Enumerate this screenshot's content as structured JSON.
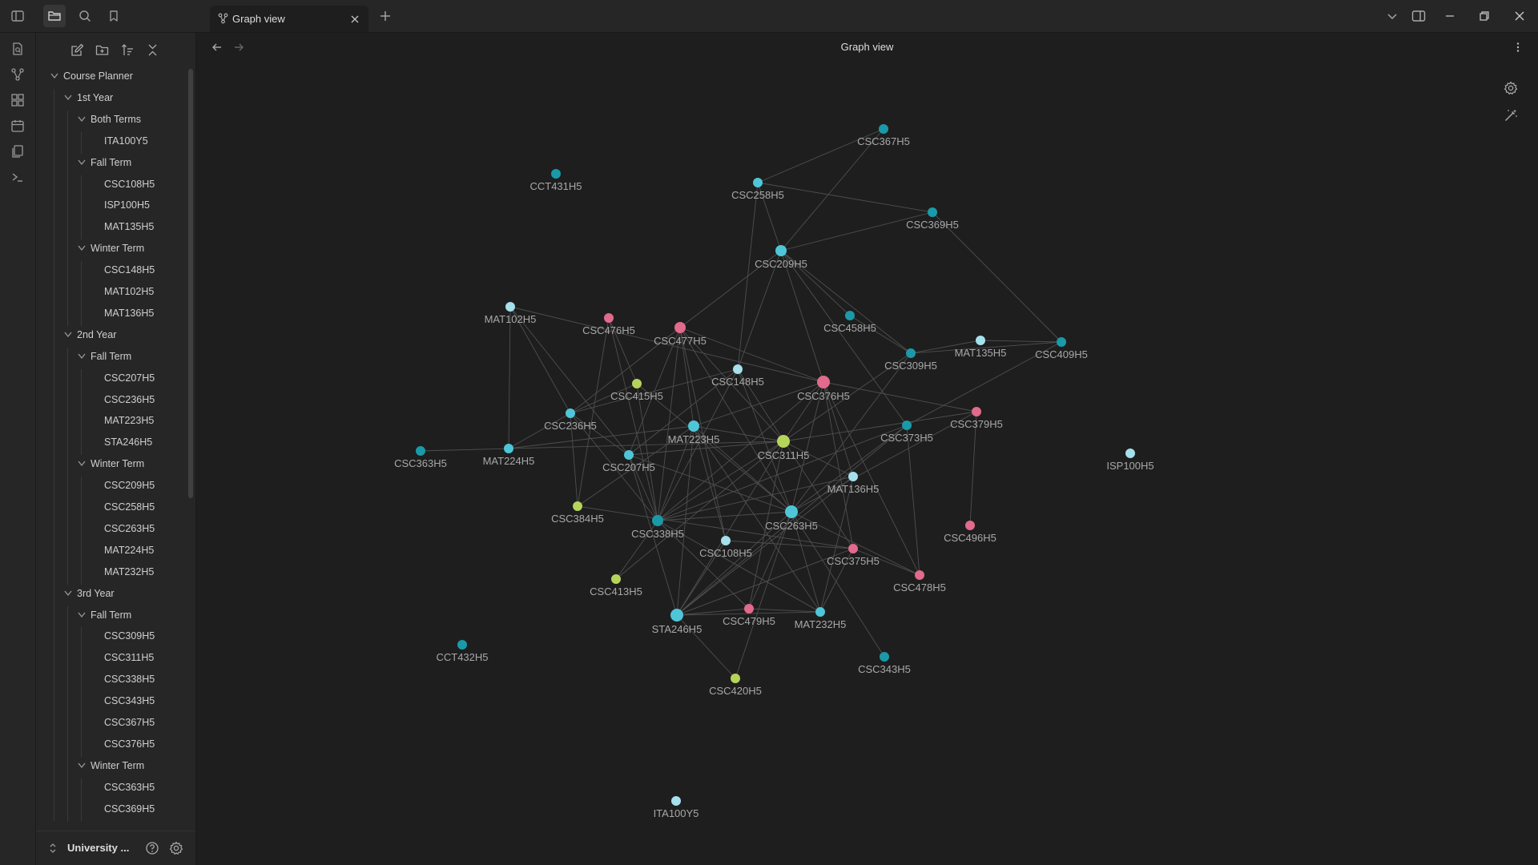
{
  "tab": {
    "title": "Graph view"
  },
  "view": {
    "title": "Graph view"
  },
  "sidebar": {
    "vault_name": "University ...",
    "tree": [
      {
        "label": "Course Planner",
        "depth": 0,
        "folder": true
      },
      {
        "label": "1st Year",
        "depth": 1,
        "folder": true
      },
      {
        "label": "Both Terms",
        "depth": 2,
        "folder": true
      },
      {
        "label": "ITA100Y5",
        "depth": 3,
        "folder": false
      },
      {
        "label": "Fall Term",
        "depth": 2,
        "folder": true
      },
      {
        "label": "CSC108H5",
        "depth": 3,
        "folder": false
      },
      {
        "label": "ISP100H5",
        "depth": 3,
        "folder": false
      },
      {
        "label": "MAT135H5",
        "depth": 3,
        "folder": false
      },
      {
        "label": "Winter Term",
        "depth": 2,
        "folder": true
      },
      {
        "label": "CSC148H5",
        "depth": 3,
        "folder": false
      },
      {
        "label": "MAT102H5",
        "depth": 3,
        "folder": false
      },
      {
        "label": "MAT136H5",
        "depth": 3,
        "folder": false
      },
      {
        "label": "2nd Year",
        "depth": 1,
        "folder": true
      },
      {
        "label": "Fall Term",
        "depth": 2,
        "folder": true
      },
      {
        "label": "CSC207H5",
        "depth": 3,
        "folder": false
      },
      {
        "label": "CSC236H5",
        "depth": 3,
        "folder": false
      },
      {
        "label": "MAT223H5",
        "depth": 3,
        "folder": false
      },
      {
        "label": "STA246H5",
        "depth": 3,
        "folder": false
      },
      {
        "label": "Winter Term",
        "depth": 2,
        "folder": true
      },
      {
        "label": "CSC209H5",
        "depth": 3,
        "folder": false
      },
      {
        "label": "CSC258H5",
        "depth": 3,
        "folder": false
      },
      {
        "label": "CSC263H5",
        "depth": 3,
        "folder": false
      },
      {
        "label": "MAT224H5",
        "depth": 3,
        "folder": false
      },
      {
        "label": "MAT232H5",
        "depth": 3,
        "folder": false
      },
      {
        "label": "3rd Year",
        "depth": 1,
        "folder": true
      },
      {
        "label": "Fall Term",
        "depth": 2,
        "folder": true
      },
      {
        "label": "CSC309H5",
        "depth": 3,
        "folder": false
      },
      {
        "label": "CSC311H5",
        "depth": 3,
        "folder": false
      },
      {
        "label": "CSC338H5",
        "depth": 3,
        "folder": false
      },
      {
        "label": "CSC343H5",
        "depth": 3,
        "folder": false
      },
      {
        "label": "CSC367H5",
        "depth": 3,
        "folder": false
      },
      {
        "label": "CSC376H5",
        "depth": 3,
        "folder": false
      },
      {
        "label": "Winter Term",
        "depth": 2,
        "folder": true
      },
      {
        "label": "CSC363H5",
        "depth": 3,
        "folder": false
      },
      {
        "label": "CSC369H5",
        "depth": 3,
        "folder": false
      }
    ]
  },
  "colors": {
    "light": "#a5e0ec",
    "cyan": "#4fc6d8",
    "teal": "#1a9aa8",
    "pink": "#e26a8c",
    "lime": "#b6d45c",
    "edge": "#4f4f4f",
    "label": "#a8a8a8"
  },
  "graph": {
    "nodes": [
      {
        "id": "CSC367H5",
        "color": "teal"
      },
      {
        "id": "CCT431H5",
        "color": "teal"
      },
      {
        "id": "CSC258H5",
        "color": "cyan"
      },
      {
        "id": "CSC369H5",
        "color": "teal"
      },
      {
        "id": "CSC209H5",
        "color": "cyan"
      },
      {
        "id": "MAT102H5",
        "color": "light"
      },
      {
        "id": "CSC476H5",
        "color": "pink"
      },
      {
        "id": "CSC477H5",
        "color": "pink"
      },
      {
        "id": "CSC458H5",
        "color": "teal"
      },
      {
        "id": "MAT135H5",
        "color": "light"
      },
      {
        "id": "CSC409H5",
        "color": "teal"
      },
      {
        "id": "CSC309H5",
        "color": "teal"
      },
      {
        "id": "CSC148H5",
        "color": "light"
      },
      {
        "id": "CSC415H5",
        "color": "lime"
      },
      {
        "id": "CSC376H5",
        "color": "pink"
      },
      {
        "id": "CSC379H5",
        "color": "pink"
      },
      {
        "id": "CSC236H5",
        "color": "cyan"
      },
      {
        "id": "MAT223H5",
        "color": "cyan"
      },
      {
        "id": "CSC373H5",
        "color": "teal"
      },
      {
        "id": "CSC363H5",
        "color": "teal"
      },
      {
        "id": "MAT224H5",
        "color": "cyan"
      },
      {
        "id": "CSC207H5",
        "color": "cyan"
      },
      {
        "id": "CSC311H5",
        "color": "lime"
      },
      {
        "id": "ISP100H5",
        "color": "light"
      },
      {
        "id": "MAT136H5",
        "color": "light"
      },
      {
        "id": "CSC384H5",
        "color": "lime"
      },
      {
        "id": "CSC338H5",
        "color": "teal"
      },
      {
        "id": "CSC263H5",
        "color": "cyan"
      },
      {
        "id": "CSC496H5",
        "color": "pink"
      },
      {
        "id": "CSC108H5",
        "color": "light"
      },
      {
        "id": "CSC375H5",
        "color": "pink"
      },
      {
        "id": "CSC478H5",
        "color": "pink"
      },
      {
        "id": "CSC413H5",
        "color": "lime"
      },
      {
        "id": "STA246H5",
        "color": "cyan"
      },
      {
        "id": "CSC479H5",
        "color": "pink"
      },
      {
        "id": "MAT232H5",
        "color": "cyan"
      },
      {
        "id": "CCT432H5",
        "color": "teal"
      },
      {
        "id": "CSC343H5",
        "color": "teal"
      },
      {
        "id": "CSC420H5",
        "color": "lime"
      },
      {
        "id": "ITA100Y5",
        "color": "light"
      }
    ],
    "edges": [
      [
        "CSC367H5",
        "CSC258H5"
      ],
      [
        "CSC367H5",
        "CSC209H5"
      ],
      [
        "CSC258H5",
        "CSC369H5"
      ],
      [
        "CSC209H5",
        "CSC369H5"
      ],
      [
        "CSC258H5",
        "CSC209H5"
      ],
      [
        "CSC258H5",
        "CSC148H5"
      ],
      [
        "CSC369H5",
        "CSC409H5"
      ],
      [
        "CSC209H5",
        "CSC148H5"
      ],
      [
        "CSC209H5",
        "CSC309H5"
      ],
      [
        "CSC209H5",
        "CSC458H5"
      ],
      [
        "CSC209H5",
        "CSC376H5"
      ],
      [
        "CSC209H5",
        "CSC477H5"
      ],
      [
        "CSC209H5",
        "CSC373H5"
      ],
      [
        "MAT135H5",
        "CSC409H5"
      ],
      [
        "MAT135H5",
        "CSC309H5"
      ],
      [
        "CSC309H5",
        "CSC409H5"
      ],
      [
        "CSC458H5",
        "CSC309H5"
      ],
      [
        "CSC409H5",
        "CSC373H5"
      ],
      [
        "MAT102H5",
        "CSC236H5"
      ],
      [
        "MAT102H5",
        "MAT224H5"
      ],
      [
        "MAT102H5",
        "CSC376H5"
      ],
      [
        "MAT102H5",
        "CSC207H5"
      ],
      [
        "CSC476H5",
        "CSC415H5"
      ],
      [
        "CSC476H5",
        "CSC384H5"
      ],
      [
        "CSC476H5",
        "CSC338H5"
      ],
      [
        "CSC477H5",
        "CSC236H5"
      ],
      [
        "CSC477H5",
        "CSC311H5"
      ],
      [
        "CSC477H5",
        "MAT223H5"
      ],
      [
        "CSC477H5",
        "CSC338H5"
      ],
      [
        "CSC477H5",
        "CSC207H5"
      ],
      [
        "CSC477H5",
        "CSC108H5"
      ],
      [
        "CSC477H5",
        "CSC263H5"
      ],
      [
        "CSC477H5",
        "CSC376H5"
      ],
      [
        "CSC148H5",
        "CSC207H5"
      ],
      [
        "CSC148H5",
        "CSC236H5"
      ],
      [
        "CSC148H5",
        "CSC263H5"
      ],
      [
        "CSC148H5",
        "CSC338H5"
      ],
      [
        "CSC148H5",
        "CSC375H5"
      ],
      [
        "CSC415H5",
        "CSC338H5"
      ],
      [
        "CSC415H5",
        "CSC236H5"
      ],
      [
        "CSC415H5",
        "CSC263H5"
      ],
      [
        "CSC376H5",
        "MAT223H5"
      ],
      [
        "CSC376H5",
        "CSC311H5"
      ],
      [
        "CSC376H5",
        "CSC263H5"
      ],
      [
        "CSC376H5",
        "CSC478H5"
      ],
      [
        "CSC376H5",
        "CSC379H5"
      ],
      [
        "CSC376H5",
        "MAT136H5"
      ],
      [
        "CSC376H5",
        "CSC338H5"
      ],
      [
        "CSC376H5",
        "CSC375H5"
      ],
      [
        "CSC309H5",
        "CSC311H5"
      ],
      [
        "CSC309H5",
        "CSC263H5"
      ],
      [
        "CSC379H5",
        "CSC496H5"
      ],
      [
        "CSC379H5",
        "CSC263H5"
      ],
      [
        "CSC379H5",
        "CSC311H5"
      ],
      [
        "CSC373H5",
        "CSC263H5"
      ],
      [
        "CSC373H5",
        "CSC478H5"
      ],
      [
        "CSC373H5",
        "CSC338H5"
      ],
      [
        "CSC373H5",
        "STA246H5"
      ],
      [
        "CSC236H5",
        "MAT224H5"
      ],
      [
        "CSC236H5",
        "CSC207H5"
      ],
      [
        "CSC236H5",
        "CSC384H5"
      ],
      [
        "CSC236H5",
        "CSC338H5"
      ],
      [
        "MAT223H5",
        "MAT224H5"
      ],
      [
        "MAT223H5",
        "CSC311H5"
      ],
      [
        "MAT223H5",
        "CSC338H5"
      ],
      [
        "MAT223H5",
        "CSC263H5"
      ],
      [
        "MAT223H5",
        "CSC108H5"
      ],
      [
        "MAT223H5",
        "MAT232H5"
      ],
      [
        "MAT223H5",
        "STA246H5"
      ],
      [
        "CSC363H5",
        "CSC311H5"
      ],
      [
        "CSC207H5",
        "CSC311H5"
      ],
      [
        "CSC207H5",
        "CSC263H5"
      ],
      [
        "CSC207H5",
        "CSC338H5"
      ],
      [
        "CSC207H5",
        "STA246H5"
      ],
      [
        "CSC311H5",
        "CSC338H5"
      ],
      [
        "CSC311H5",
        "STA246H5"
      ],
      [
        "CSC311H5",
        "MAT136H5"
      ],
      [
        "CSC311H5",
        "CSC479H5"
      ],
      [
        "CSC311H5",
        "CSC413H5"
      ],
      [
        "MAT136H5",
        "STA246H5"
      ],
      [
        "MAT136H5",
        "MAT232H5"
      ],
      [
        "MAT136H5",
        "CSC338H5"
      ],
      [
        "CSC384H5",
        "CSC375H5"
      ],
      [
        "CSC338H5",
        "CSC263H5"
      ],
      [
        "CSC338H5",
        "CSC479H5"
      ],
      [
        "CSC338H5",
        "MAT232H5"
      ],
      [
        "CSC263H5",
        "STA246H5"
      ],
      [
        "CSC263H5",
        "CSC479H5"
      ],
      [
        "CSC263H5",
        "CSC420H5"
      ],
      [
        "CSC263H5",
        "CSC478H5"
      ],
      [
        "CSC108H5",
        "CSC375H5"
      ],
      [
        "CSC108H5",
        "STA246H5"
      ],
      [
        "CSC375H5",
        "CSC478H5"
      ],
      [
        "CSC375H5",
        "STA246H5"
      ],
      [
        "CSC375H5",
        "MAT232H5"
      ],
      [
        "CSC413H5",
        "CSC338H5"
      ],
      [
        "STA246H5",
        "CSC479H5"
      ],
      [
        "STA246H5",
        "MAT232H5"
      ],
      [
        "STA246H5",
        "CSC420H5"
      ],
      [
        "CSC479H5",
        "MAT232H5"
      ],
      [
        "CSC343H5",
        "CSC263H5"
      ],
      [
        "MAT232H5",
        "CSC263H5"
      ],
      [
        "CSC384H5",
        "MAT223H5"
      ]
    ]
  }
}
